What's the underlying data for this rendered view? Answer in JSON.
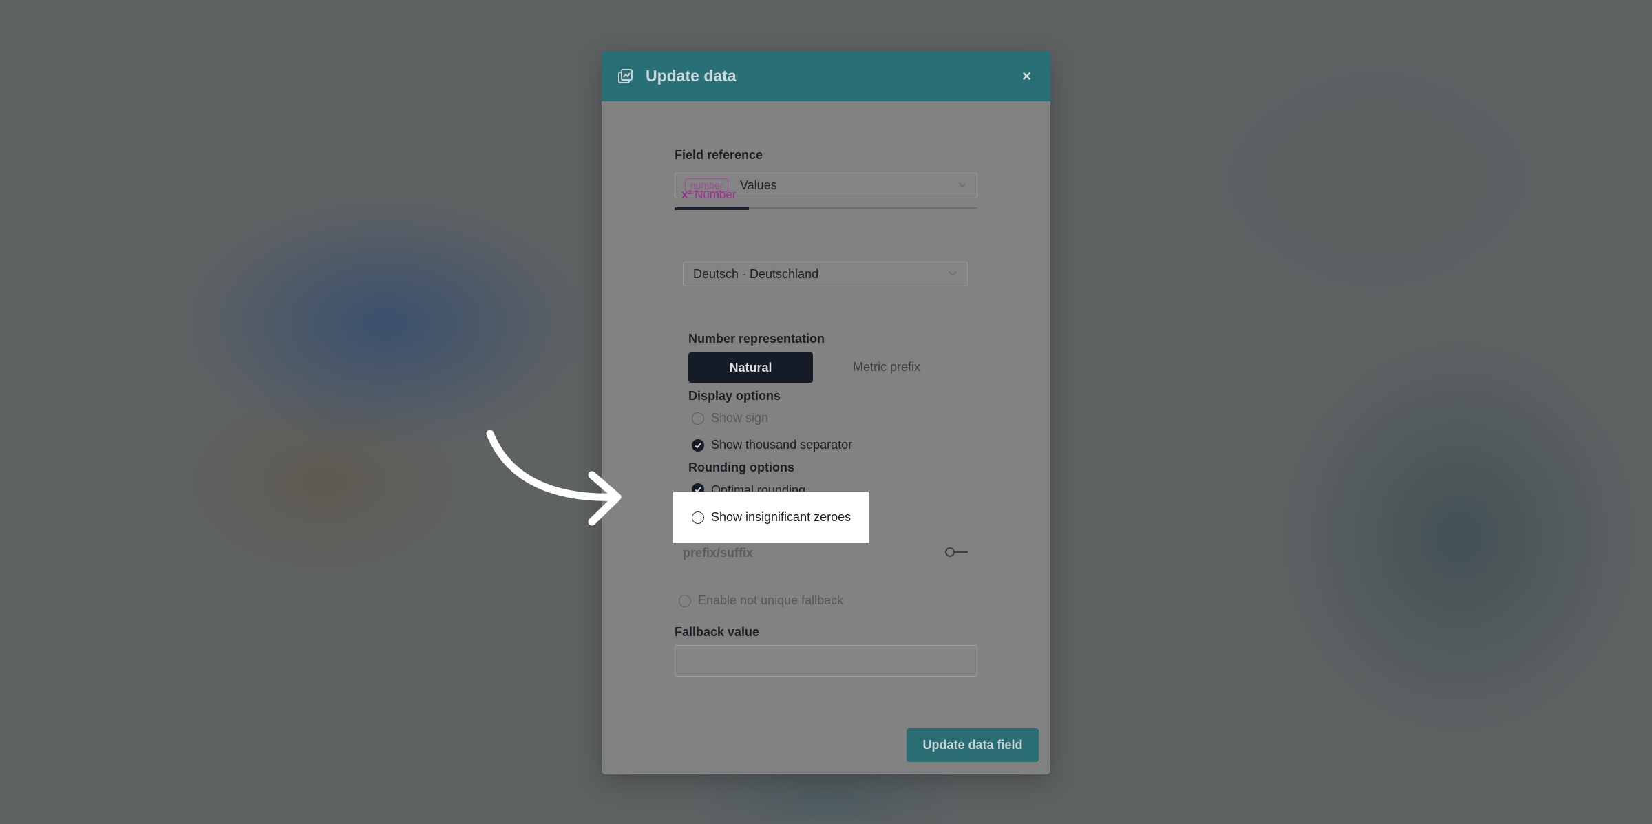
{
  "modal": {
    "title": "Update data",
    "close_label": "×",
    "field_reference_label": "Field reference",
    "field_type_tag": "number",
    "field_value": "Values",
    "tab_icon_text": "x²",
    "tab_label": "Number",
    "locale_value": "Deutsch - Deutschland",
    "number_representation_label": "Number representation",
    "seg_natural": "Natural",
    "seg_metric": "Metric prefix",
    "display_options_label": "Display options",
    "show_sign": {
      "label": "Show sign",
      "checked": false
    },
    "show_thousand_separator": {
      "label": "Show thousand separator",
      "checked": true
    },
    "rounding_options_label": "Rounding options",
    "optimal_rounding": {
      "label": "Optimal rounding",
      "checked": true
    },
    "show_insignificant_zeroes": {
      "label": "Show insignificant zeroes",
      "checked": false
    },
    "prefix_suffix_label": "prefix/suffix",
    "enable_not_unique_fallback": {
      "label": "Enable not unique fallback",
      "checked": false
    },
    "fallback_value_label": "Fallback value",
    "fallback_value": "",
    "update_button_label": "Update data field"
  },
  "colors": {
    "header": "#296f76",
    "accent_purple": "#a4499a",
    "dark_button": "#161c27",
    "highlight": "#ffffff"
  }
}
